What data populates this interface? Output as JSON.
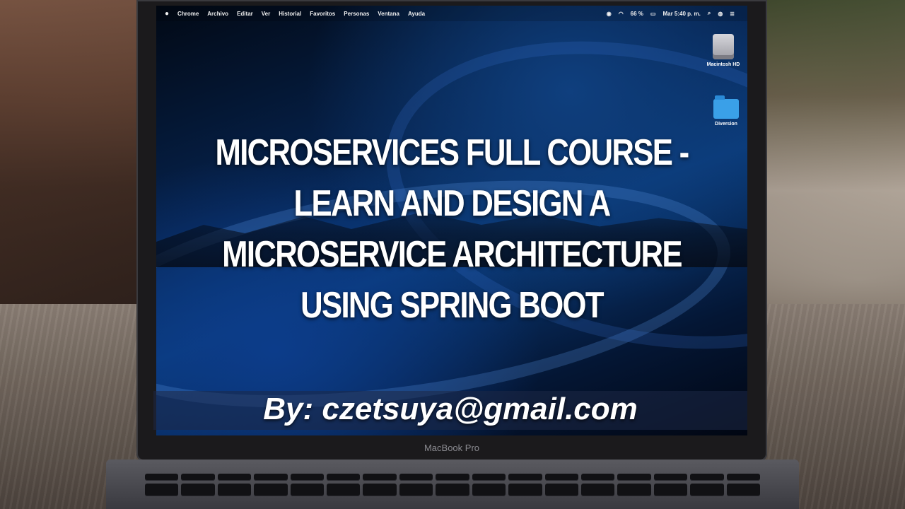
{
  "menubar": {
    "apple": "",
    "items": [
      "Chrome",
      "Archivo",
      "Editar",
      "Ver",
      "Historial",
      "Favoritos",
      "Personas",
      "Ventana",
      "Ayuda"
    ],
    "battery": "66 %",
    "clock": "Mar 5:40 p. m."
  },
  "desktop": {
    "icons": [
      {
        "label": "Macintosh HD",
        "icon": "hard-drive-icon"
      },
      {
        "label": "Diversion",
        "icon": "folder-icon"
      }
    ]
  },
  "title": {
    "line1": "MICROSERVICES FULL COURSE -",
    "line2": "LEARN AND DESIGN A",
    "line3": "MICROSERVICE ARCHITECTURE",
    "line4": "USING SPRING BOOT"
  },
  "author": "By: czetsuya@gmail.com",
  "device_brand": "MacBook Pro",
  "colors": {
    "screen_blue": "#0a3b7a",
    "text": "#ffffff",
    "folder": "#3aa0e8"
  }
}
